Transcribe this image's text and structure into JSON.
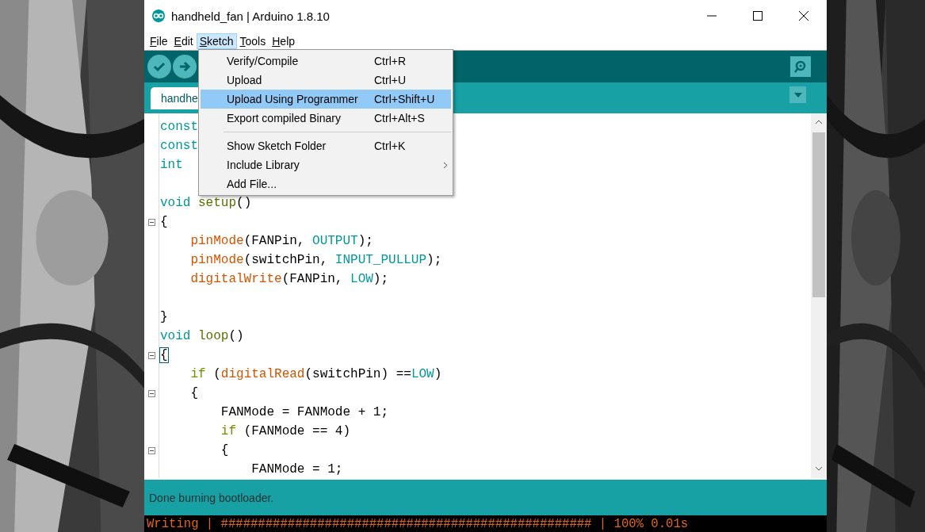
{
  "window": {
    "title": "handheld_fan | Arduino 1.8.10"
  },
  "menubar": [
    {
      "label": "File",
      "selected": false
    },
    {
      "label": "Edit",
      "selected": false
    },
    {
      "label": "Sketch",
      "selected": true
    },
    {
      "label": "Tools",
      "selected": false
    },
    {
      "label": "Help",
      "selected": false
    }
  ],
  "dropdown": [
    {
      "kind": "item",
      "label": "Verify/Compile",
      "shortcut": "Ctrl+R",
      "selected": false,
      "submenu": false
    },
    {
      "kind": "item",
      "label": "Upload",
      "shortcut": "Ctrl+U",
      "selected": false,
      "submenu": false
    },
    {
      "kind": "item",
      "label": "Upload Using Programmer",
      "shortcut": "Ctrl+Shift+U",
      "selected": true,
      "submenu": false
    },
    {
      "kind": "item",
      "label": "Export compiled Binary",
      "shortcut": "Ctrl+Alt+S",
      "selected": false,
      "submenu": false
    },
    {
      "kind": "separator"
    },
    {
      "kind": "item",
      "label": "Show Sketch Folder",
      "shortcut": "Ctrl+K",
      "selected": false,
      "submenu": false
    },
    {
      "kind": "item",
      "label": "Include Library",
      "selected": false,
      "submenu": true
    },
    {
      "kind": "item",
      "label": "Add File...",
      "selected": false,
      "submenu": false
    }
  ],
  "tabs": [
    {
      "label": "handhe",
      "selected": true
    }
  ],
  "code": [
    {
      "fold": false,
      "tokens": [
        {
          "kind": "type",
          "text": "const"
        }
      ]
    },
    {
      "fold": false,
      "tokens": [
        {
          "kind": "type",
          "text": "const"
        }
      ]
    },
    {
      "fold": false,
      "tokens": [
        {
          "kind": "type",
          "text": "int"
        }
      ]
    },
    {
      "fold": false
    },
    {
      "fold": false,
      "tokens": [
        {
          "kind": "type",
          "text": "void "
        },
        {
          "kind": "func",
          "text": "setup"
        },
        {
          "kind": "plain",
          "text": "()"
        }
      ]
    },
    {
      "fold": true,
      "tokens": [
        {
          "kind": "plain",
          "text": "{"
        }
      ]
    },
    {
      "fold": false,
      "tokens": [
        {
          "kind": "builtin",
          "text": "    pinMode"
        },
        {
          "kind": "plain",
          "text": "(FANPin, "
        },
        {
          "kind": "const",
          "text": "OUTPUT"
        },
        {
          "kind": "plain",
          "text": ");"
        }
      ]
    },
    {
      "fold": false,
      "tokens": [
        {
          "kind": "builtin",
          "text": "    pinMode"
        },
        {
          "kind": "plain",
          "text": "(switchPin, "
        },
        {
          "kind": "const",
          "text": "INPUT_PULLUP"
        },
        {
          "kind": "plain",
          "text": ");"
        }
      ]
    },
    {
      "fold": false,
      "tokens": [
        {
          "kind": "builtin",
          "text": "    digitalWrite"
        },
        {
          "kind": "plain",
          "text": "(FANPin, "
        },
        {
          "kind": "const",
          "text": "LOW"
        },
        {
          "kind": "plain",
          "text": ");"
        }
      ]
    },
    {
      "fold": false
    },
    {
      "fold": false,
      "tokens": [
        {
          "kind": "plain",
          "text": "}"
        }
      ]
    },
    {
      "fold": false,
      "tokens": [
        {
          "kind": "type",
          "text": "void "
        },
        {
          "kind": "func",
          "text": "loop"
        },
        {
          "kind": "plain",
          "text": "()"
        }
      ]
    },
    {
      "fold": true,
      "tokens": [
        {
          "kind": "bracket",
          "text": "{"
        }
      ]
    },
    {
      "fold": false,
      "tokens": [
        {
          "kind": "control",
          "text": "    if "
        },
        {
          "kind": "plain",
          "text": "("
        },
        {
          "kind": "builtin",
          "text": "digitalRead"
        },
        {
          "kind": "plain",
          "text": "(switchPin) =="
        },
        {
          "kind": "const",
          "text": "LOW"
        },
        {
          "kind": "plain",
          "text": ")"
        }
      ]
    },
    {
      "fold": true,
      "tokens": [
        {
          "kind": "plain",
          "text": "    {"
        }
      ]
    },
    {
      "fold": false,
      "tokens": [
        {
          "kind": "plain",
          "text": "        FANMode = FANMode + 1;"
        }
      ]
    },
    {
      "fold": false,
      "tokens": [
        {
          "kind": "control",
          "text": "        if "
        },
        {
          "kind": "plain",
          "text": "(FANMode == 4)"
        }
      ]
    },
    {
      "fold": true,
      "tokens": [
        {
          "kind": "plain",
          "text": "        {"
        }
      ]
    },
    {
      "fold": false,
      "tokens": [
        {
          "kind": "plain",
          "text": "            FANMode = 1;"
        }
      ]
    }
  ],
  "status": "Done burning bootloader.",
  "console": "Writing | ################################################## | 100% 0.01s"
}
